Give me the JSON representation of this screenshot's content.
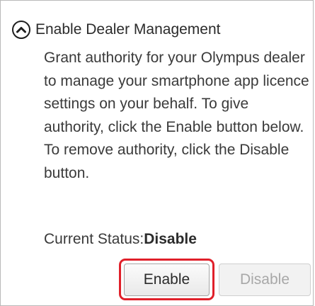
{
  "section": {
    "title": "Enable Dealer Management",
    "toggle_icon": "chevron-up-circle-icon",
    "description": "Grant authority for your Olympus dealer to manage your smartphone app licence settings on your behalf. To give authority, click the Enable button below. To remove authority, click the Disable button.",
    "status_label": "Current Status:",
    "status_value": "Disable"
  },
  "buttons": {
    "enable_label": "Enable",
    "disable_label": "Disable",
    "disable_enabled": false
  },
  "colors": {
    "highlight": "#e0202a",
    "text": "#3a3a3a",
    "disabled_text": "#a8a8a8",
    "border": "#b9b9b9"
  }
}
